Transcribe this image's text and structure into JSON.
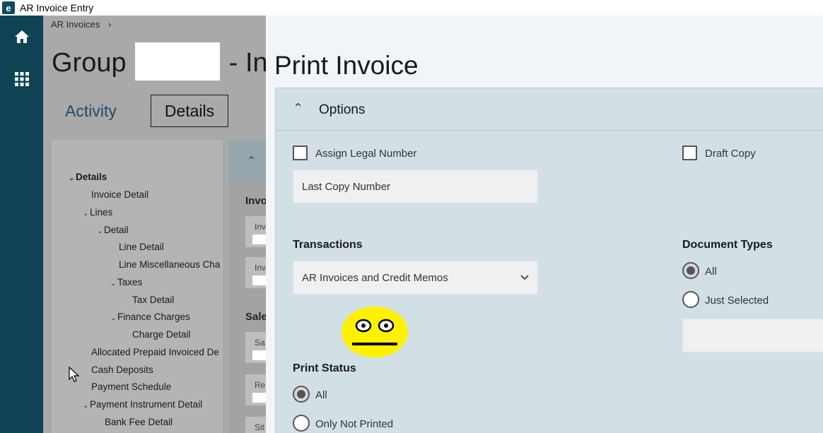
{
  "window": {
    "title": "AR Invoice Entry",
    "logo_letter": "e"
  },
  "rail": {
    "icons": [
      "home-icon",
      "apps-grid-icon"
    ]
  },
  "background_page": {
    "breadcrumb": "AR Invoices",
    "breadcrumb_sep": "›",
    "title_prefix": "Group",
    "title_suffix": "- Inv",
    "tabs": [
      {
        "label": "Activity"
      },
      {
        "label": "Details",
        "selected": true
      }
    ],
    "tree": [
      {
        "label": "Details",
        "expanded": true,
        "bold": true
      },
      {
        "label": "Invoice Detail"
      },
      {
        "label": "Lines",
        "expanded": true
      },
      {
        "label": "Detail",
        "expanded": true
      },
      {
        "label": "Line Detail"
      },
      {
        "label": "Line Miscellaneous Cha"
      },
      {
        "label": "Taxes",
        "expanded": true
      },
      {
        "label": "Tax Detail"
      },
      {
        "label": "Finance Charges",
        "expanded": true
      },
      {
        "label": "Charge Detail"
      },
      {
        "label": "Allocated Prepaid Invoiced De"
      },
      {
        "label": "Cash Deposits"
      },
      {
        "label": "Payment Schedule"
      },
      {
        "label": "Payment Instrument Detail",
        "expanded": true
      },
      {
        "label": "Bank Fee Detail"
      }
    ],
    "detail_panel": {
      "section1": "Invo",
      "fields1": [
        "Inv",
        "Inv"
      ],
      "section2": "Sale",
      "fields2": [
        "Sa",
        "Re",
        "Sit"
      ]
    }
  },
  "modal": {
    "title": "Print Invoice",
    "section": "Options",
    "assign_legal_number": {
      "label": "Assign Legal Number",
      "checked": false
    },
    "draft_copy": {
      "label": "Draft Copy",
      "checked": false
    },
    "last_copy_number": {
      "placeholder": "Last Copy Number",
      "value": ""
    },
    "transactions": {
      "label": "Transactions",
      "value": "AR Invoices and Credit Memos"
    },
    "document_types": {
      "label": "Document Types",
      "options": [
        "All",
        "Just Selected"
      ],
      "selected": "All"
    },
    "print_status": {
      "label": "Print Status",
      "options": [
        "All",
        "Only Not Printed"
      ],
      "selected": "All"
    }
  },
  "colors": {
    "rail": "#0d4352",
    "accent": "#1e4a6e",
    "options_bg": "#d2e0e5"
  }
}
